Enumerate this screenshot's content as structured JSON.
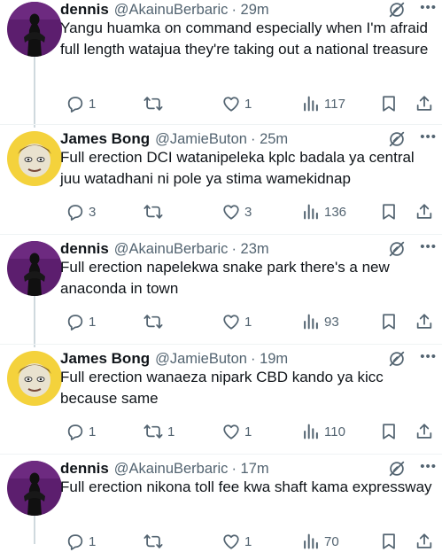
{
  "tweets": [
    {
      "name": "dennis",
      "handle": "@AkainuBerbaric",
      "time": "· 29m",
      "text": "Yangu huamka on command especially when I'm afraid full length watajua they're taking out a national treasure",
      "replies": "1",
      "retweets": "",
      "likes": "1",
      "views": "117",
      "avatar": "dark-silhouette"
    },
    {
      "name": "James Bong",
      "handle": "@JamieButon",
      "time": "· 25m",
      "text": "Full erection DCI watanipeleka kplc badala ya central juu watadhani ni pole ya stima wamekidnap",
      "replies": "3",
      "retweets": "",
      "likes": "3",
      "views": "136",
      "avatar": "cartoon-face"
    },
    {
      "name": "dennis",
      "handle": "@AkainuBerbaric",
      "time": "· 23m",
      "text": "Full erection napelekwa snake park there's a new anaconda in town",
      "replies": "1",
      "retweets": "",
      "likes": "1",
      "views": "93",
      "avatar": "dark-silhouette"
    },
    {
      "name": "James Bong",
      "handle": "@JamieButon",
      "time": "· 19m",
      "text": "Full erection wanaeza nipark CBD kando ya kicc because same",
      "replies": "1",
      "retweets": "1",
      "likes": "1",
      "views": "110",
      "avatar": "cartoon-face"
    },
    {
      "name": "dennis",
      "handle": "@AkainuBerbaric",
      "time": "· 17m",
      "text": "Full erection nikona toll fee kwa shaft kama expressway",
      "replies": "1",
      "retweets": "",
      "likes": "1",
      "views": "70",
      "avatar": "dark-silhouette"
    }
  ],
  "icons": {
    "reply": "reply-icon",
    "retweet": "retweet-icon",
    "like": "heart-icon",
    "views": "views-icon",
    "bookmark": "bookmark-icon",
    "share": "share-icon",
    "grok": "grok-icon",
    "more": "more-icon"
  },
  "more_glyph": "•••",
  "colors": {
    "text": "#0f1419",
    "secondary": "#536471",
    "thread_line": "#cfd9de",
    "avatar_purple": "#5c1e6e",
    "avatar_yellow": "#f4d23c"
  }
}
